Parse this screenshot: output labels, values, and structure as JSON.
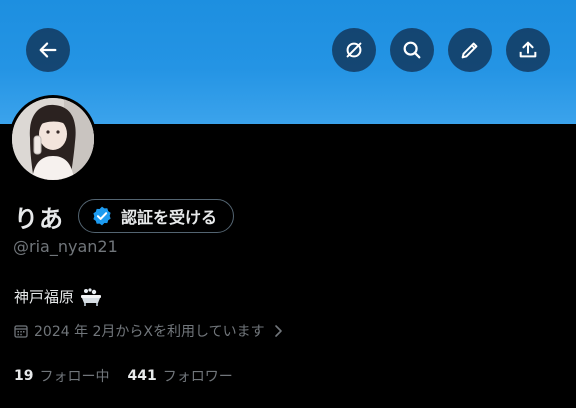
{
  "profile": {
    "display_name": "りあ",
    "handle": "@ria_nyan21",
    "bio": "神戸福原",
    "joined": "2024 年 2月からXを利用しています",
    "following_count": "19",
    "following_label": "フォロー中",
    "followers_count": "441",
    "followers_label": "フォロワー"
  },
  "verify_button": {
    "label": "認証を受ける"
  },
  "icons": {
    "back": "arrow-left-icon",
    "noedit": "grok-slash-icon",
    "search": "search-icon",
    "edit": "pencil-icon",
    "share": "share-upload-icon",
    "verified": "verified-badge-icon",
    "calendar": "calendar-icon",
    "chevron": "chevron-right-icon",
    "bio_emoji": "bathtub-icon"
  },
  "colors": {
    "banner": "#2494e4",
    "background": "#000000",
    "text_primary": "#e7e9ea",
    "text_secondary": "#71767b",
    "verified_blue": "#1d9bf0"
  }
}
